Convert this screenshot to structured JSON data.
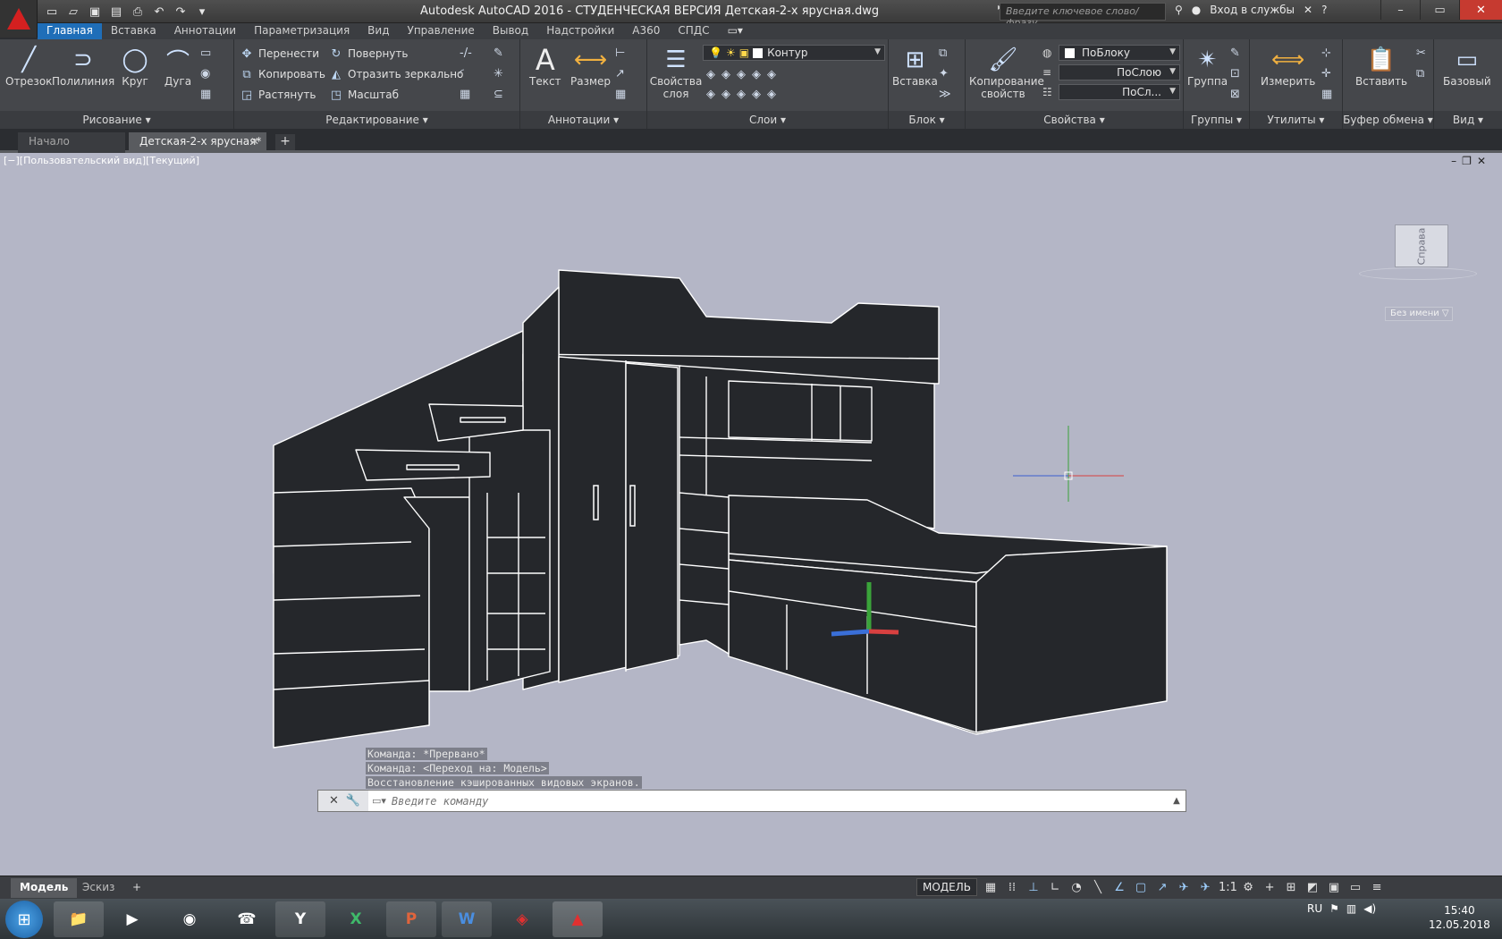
{
  "title_bar": {
    "title": "Autodesk AutoCAD 2016 - СТУДЕНЧЕСКАЯ ВЕРСИЯ    Детская-2-х ярусная.dwg",
    "search_placeholder": "Введите ключевое слово/фразу",
    "sign_in": "Вход в службы",
    "help": "?"
  },
  "menu_tabs": [
    "Главная",
    "Вставка",
    "Аннотации",
    "Параметризация",
    "Вид",
    "Управление",
    "Вывод",
    "Надстройки",
    "A360",
    "СПДС"
  ],
  "ribbon": {
    "draw": {
      "label": "Рисование",
      "line": "Отрезок",
      "polyline": "Полилиния",
      "circle": "Круг",
      "arc": "Дуга"
    },
    "modify": {
      "label": "Редактирование",
      "move": "Перенести",
      "rotate": "Повернуть",
      "copy": "Копировать",
      "mirror": "Отразить зеркально",
      "stretch": "Растянуть",
      "scale": "Масштаб"
    },
    "annotation": {
      "label": "Аннотации",
      "text": "Текст",
      "dimension": "Размер"
    },
    "layers": {
      "label": "Слои",
      "properties": "Свойства слоя",
      "current_layer": "Контур"
    },
    "block": {
      "label": "Блок",
      "insert": "Вставка"
    },
    "properties": {
      "label": "Свойства",
      "match": "Копирование свойств",
      "color": "ПоБлоку",
      "linetype": "ПоСлою",
      "lineweight": "ПоСл..."
    },
    "groups": {
      "label": "Группы",
      "group": "Группа"
    },
    "utilities": {
      "label": "Утилиты",
      "measure": "Измерить"
    },
    "clipboard": {
      "label": "Буфер обмена",
      "paste": "Вставить"
    },
    "view": {
      "label": "Вид",
      "base": "Базовый"
    }
  },
  "doc_tabs": {
    "start": "Начало",
    "drawing": "Детская-2-х ярусная*"
  },
  "viewport": {
    "label": "[−][Пользовательский вид][Текущий]",
    "viewcube_face": "Справа",
    "named_view": "Без имени"
  },
  "command": {
    "history": [
      "Команда: *Прервано*",
      "Команда:   <Переход на: Модель>",
      "Восстановление кэшированных видовых экранов."
    ],
    "placeholder": "Введите команду"
  },
  "layout_tabs": {
    "model": "Модель",
    "sketch": "Эскиз"
  },
  "status_bar": {
    "model": "МОДЕЛЬ",
    "scale": "1:1"
  },
  "taskbar": {
    "lang": "RU",
    "time": "15:40",
    "date": "12.05.2018"
  },
  "colors": {
    "accent": "#1f6eb8",
    "viewport_bg": "#b4b6c6",
    "model_fill": "#25272b"
  }
}
